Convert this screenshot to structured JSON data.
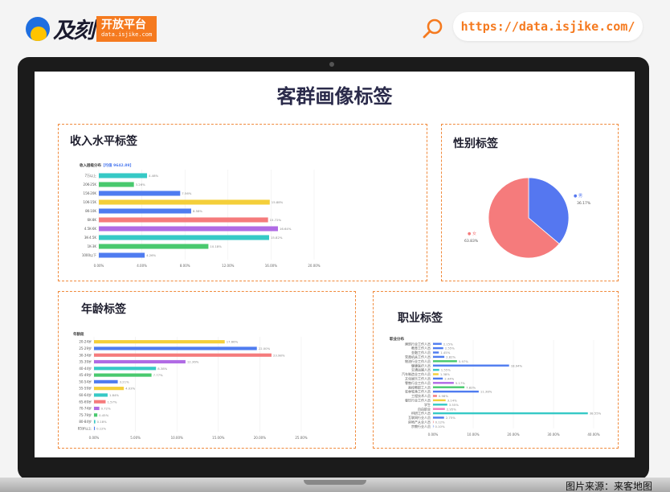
{
  "header": {
    "logo_text": "及刻",
    "logo_badge_top": "开放平台",
    "logo_badge_bottom": "data.isjike.com",
    "url": "https://data.isjike.com/",
    "search_icon": "search-icon"
  },
  "page_title": "客群画像标签",
  "source_caption": "图片来源：来客地图",
  "colors": {
    "accent": "#f57a1f",
    "dash": "#f08a3c",
    "blue": "#4f7cf0",
    "cyan": "#36c9c6",
    "green": "#49c96e",
    "yellow": "#f4cf3a",
    "red": "#f57b7c",
    "purple": "#b06be4",
    "pink": "#f07dc0"
  },
  "panels": {
    "income": {
      "title": "收入水平标签",
      "chart_title": "收入层级分布",
      "chart_sub": "【均值 9642.89】"
    },
    "gender": {
      "title": "性别标签"
    },
    "age": {
      "title": "年龄标签",
      "chart_title": "年龄段"
    },
    "job": {
      "title": "职业标签",
      "chart_title": "职业分布"
    }
  },
  "chart_data": [
    {
      "id": "income",
      "type": "bar",
      "orientation": "horizontal",
      "title": "收入层级分布",
      "categories": [
        "7万以上",
        "20K-25K",
        "15K-20K",
        "10K-15K",
        "8K-10K",
        "6K-8K",
        "4.5K-6K",
        "3K-4.5K",
        "1K-3K",
        "1000以下"
      ],
      "values": [
        4.48,
        3.26,
        7.56,
        15.88,
        8.58,
        15.72,
        16.64,
        15.82,
        10.18,
        4.26
      ],
      "value_labels": [
        "4.48%",
        "3.26%",
        "7.56%",
        "15.88%",
        "8.58%",
        "15.72%",
        "16.64%",
        "15.82%",
        "10.18%",
        "4.26%"
      ],
      "colors": [
        "#36c9c6",
        "#49c96e",
        "#4f7cf0",
        "#f4cf3a",
        "#4f7cf0",
        "#f57b7c",
        "#b06be4",
        "#36c9c6",
        "#49c96e",
        "#4f7cf0"
      ],
      "xlim": [
        0,
        20
      ],
      "xticks": [
        "0.00%",
        "4.00%",
        "8.00%",
        "12.00%",
        "16.00%",
        "20.00%"
      ]
    },
    {
      "id": "gender",
      "type": "pie",
      "labels": [
        "男",
        "女"
      ],
      "values": [
        36.17,
        63.83
      ],
      "value_labels": [
        "36.17%",
        "63.83%"
      ],
      "colors": [
        "#5577f0",
        "#f57b7c"
      ]
    },
    {
      "id": "age",
      "type": "bar",
      "orientation": "horizontal",
      "title": "年龄段",
      "categories": [
        "20-24岁",
        "25-29岁",
        "30-34岁",
        "35-39岁",
        "40-44岁",
        "45-49岁",
        "50-54岁",
        "55-59岁",
        "60-64岁",
        "65-69岁",
        "70-74岁",
        "75-79岁",
        "80-84岁",
        "85岁以上"
      ],
      "values": [
        17.66,
        22.0,
        23.98,
        12.36,
        8.38,
        7.77,
        3.21,
        4.03,
        1.84,
        1.57,
        0.72,
        0.45,
        0.18,
        0.12
      ],
      "value_labels": [
        "17.66%",
        "22.00%",
        "23.98%",
        "12.36%",
        "8.38%",
        "7.77%",
        "3.21%",
        "4.03%",
        "1.84%",
        "1.57%",
        "0.72%",
        "0.45%",
        "0.18%",
        "0.12%"
      ],
      "colors": [
        "#f4cf3a",
        "#4f7cf0",
        "#f57b7c",
        "#b06be4",
        "#36c9c6",
        "#49c96e",
        "#4f7cf0",
        "#f4cf3a",
        "#36c9c6",
        "#f57b7c",
        "#b06be4",
        "#49c96e",
        "#36c9c6",
        "#4f7cf0"
      ],
      "xlim": [
        0,
        28
      ],
      "xticks": [
        "0.00%",
        "5.00%",
        "10.00%",
        "15.00%",
        "20.00%",
        "25.00%"
      ]
    },
    {
      "id": "job",
      "type": "bar",
      "orientation": "horizontal",
      "title": "职业分布",
      "categories": [
        "建筑行业工作人员",
        "教育工作人员",
        "金融工作人员",
        "党政机关工作人员",
        "物流行业工作人员",
        "健康医疗人员",
        "交通运输人员",
        "汽车制造业工作人员",
        "文化娱乐工作人员",
        "零售行业工作人员",
        "高校教职工人员",
        "农林牧渔工作人员",
        "工程技术人员",
        "餐饮行业工作人员",
        "学生",
        "自由职业",
        "科研工作人员",
        "互联网行业人员",
        "房地产从业人员",
        "宗教行业人员"
      ],
      "values": [
        2.15,
        2.55,
        1.45,
        2.82,
        5.97,
        18.94,
        1.55,
        1.38,
        2.44,
        5.17,
        7.82,
        11.38,
        0.98,
        3.14,
        3.55,
        2.95,
        38.55,
        2.75,
        0.12,
        0.1
      ],
      "value_labels": [
        "2.15%",
        "2.55%",
        "1.45%",
        "2.82%",
        "5.97%",
        "18.94%",
        "1.55%",
        "1.38%",
        "2.44%",
        "5.17%",
        "7.82%",
        "11.38%",
        "0.98%",
        "3.14%",
        "3.55%",
        "2.95%",
        "38.55%",
        "2.75%",
        "0.12%",
        "0.10%"
      ],
      "colors": [
        "#4f7cf0",
        "#4f7cf0",
        "#4f7cf0",
        "#4f7cf0",
        "#49c96e",
        "#4f7cf0",
        "#36c9c6",
        "#f4cf3a",
        "#4f7cf0",
        "#b06be4",
        "#49c96e",
        "#4f7cf0",
        "#f57b7c",
        "#f4cf3a",
        "#36c9c6",
        "#f07dc0",
        "#36c9c6",
        "#4f7cf0",
        "#f57b7c",
        "#4f7cf0"
      ],
      "xlim": [
        0,
        40
      ],
      "xticks": [
        "0.00%",
        "10.00%",
        "20.00%",
        "30.00%",
        "40.00%"
      ]
    }
  ]
}
